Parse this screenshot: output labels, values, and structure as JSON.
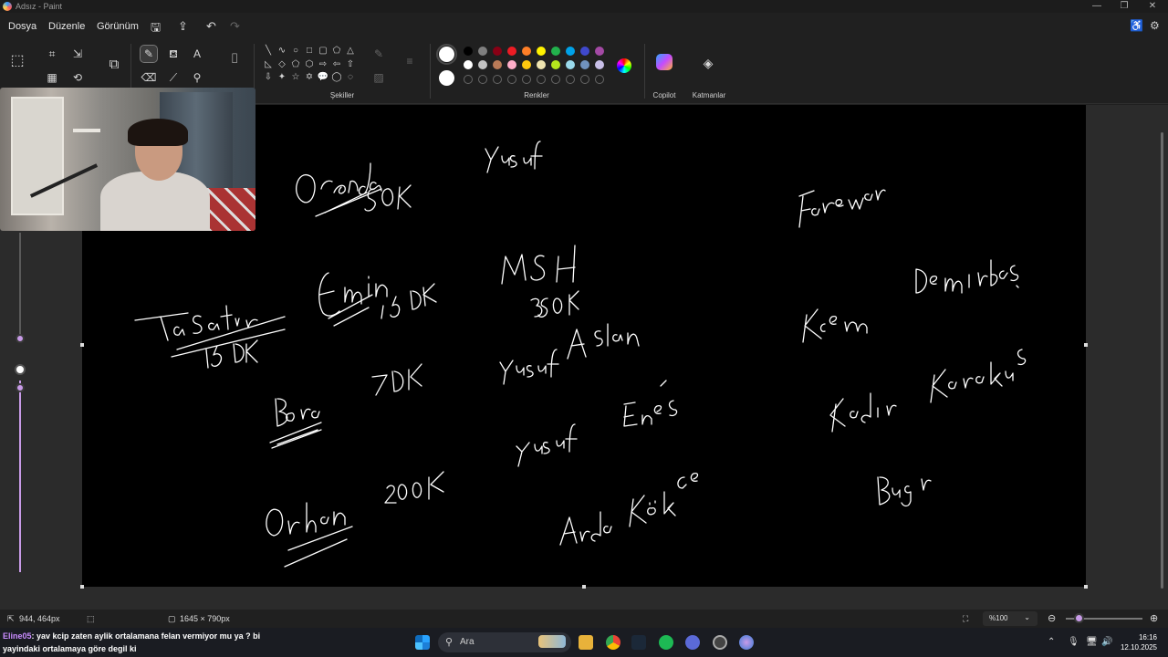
{
  "window": {
    "title": "Adsız - Paint",
    "controls": [
      "minimize",
      "restore",
      "close"
    ]
  },
  "menu": {
    "items": [
      "Dosya",
      "Düzenle",
      "Görünüm"
    ]
  },
  "ribbon": {
    "groups": {
      "shapes": "Şekiller",
      "colors": "Renkler",
      "copilot": "Copilot",
      "layers": "Katmanlar"
    },
    "palette_row1": [
      "#000000",
      "#7f7f7f",
      "#880015",
      "#ed1c24",
      "#ff7f27",
      "#fff200",
      "#22b14c",
      "#00a2e8",
      "#3f48cc",
      "#a349a4"
    ],
    "palette_row2": [
      "#ffffff",
      "#c3c3c3",
      "#b97a57",
      "#ffaec9",
      "#ffc90e",
      "#efe4b0",
      "#b5e61d",
      "#99d9ea",
      "#7092be",
      "#c8bfe7"
    ],
    "accent": "#c89be8"
  },
  "canvas": {
    "background": "#000000",
    "handwritten_text": [
      "Orenda",
      "50K",
      "Yusuf",
      "Farewar",
      "Ta Satır",
      "15DK",
      "Emin",
      "15DK",
      "MSH",
      "350K",
      "Kerem Demirbaş",
      "Yusuf Aslan",
      "Kadir Karakuş",
      "Bora",
      "7DK",
      "Yusuf Enes",
      "Orhan",
      "200K",
      "Arda Kökge",
      "Bugr"
    ]
  },
  "status": {
    "cursor": "944, 464px",
    "size": "1645 × 790px",
    "zoom": "%100"
  },
  "chat": {
    "user": "Eline05",
    "message": ": yav kcip zaten aylik ortalamana felan vermiyor mu ya ? bi yayindaki ortalamaya göre degil ki"
  },
  "taskbar": {
    "search_placeholder": "Ara"
  },
  "clock": {
    "time": "16:16",
    "date": "12.10.2025"
  }
}
